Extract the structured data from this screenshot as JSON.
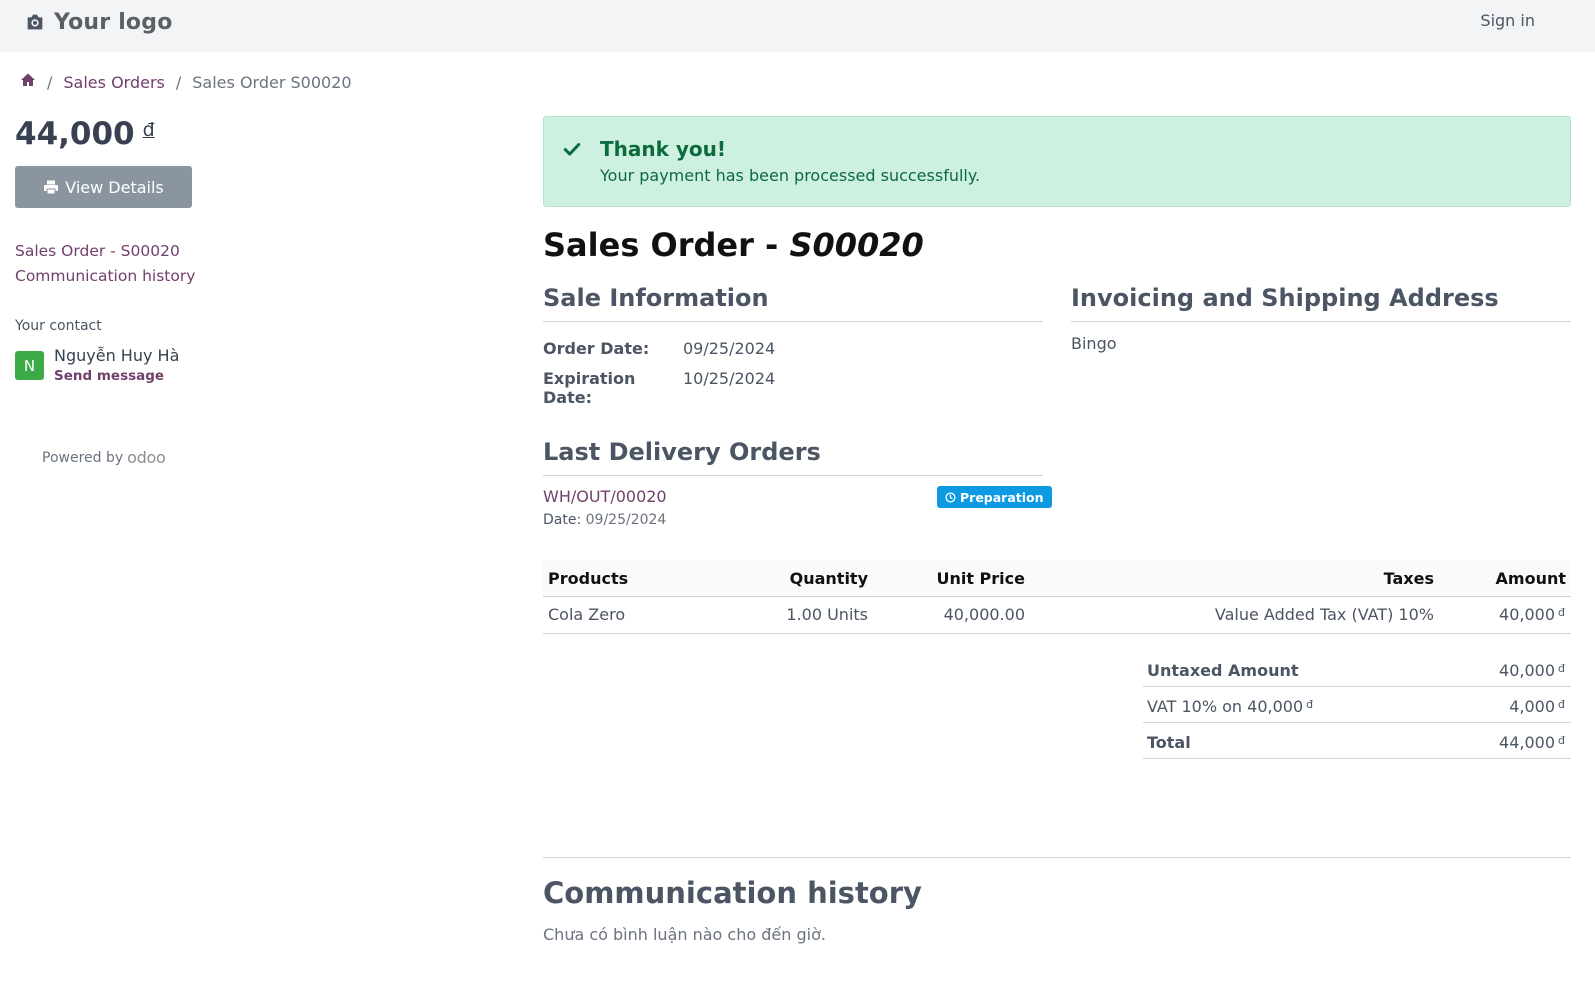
{
  "header": {
    "logo_text": "Your logo",
    "logo_icon": "camera-icon",
    "signin_label": "Sign in"
  },
  "breadcrumb": {
    "home_icon": "home-icon",
    "items": [
      "Sales Orders",
      "Sales Order S00020"
    ]
  },
  "sidebar": {
    "amount": "44,000",
    "currency": "đ",
    "view_details_label": "View Details",
    "view_details_icon": "print-icon",
    "nav": [
      "Sales Order - S00020",
      "Communication history"
    ],
    "contact_label": "Your contact",
    "contact": {
      "initial": "N",
      "name": "Nguyễn Huy Hà",
      "send_message": "Send message"
    },
    "powered_by": "Powered by",
    "brand": "odoo"
  },
  "alert": {
    "title": "Thank you!",
    "message": "Your payment has been processed successfully.",
    "icon": "check-icon"
  },
  "order": {
    "title_prefix": "Sales Order - ",
    "number": "S00020",
    "sale_info_heading": "Sale Information",
    "order_date_label": "Order Date:",
    "order_date": "09/25/2024",
    "expiration_label": "Expiration Date:",
    "expiration_date": "10/25/2024",
    "address_heading": "Invoicing and Shipping Address",
    "address": "Bingo"
  },
  "delivery": {
    "heading": "Last Delivery Orders",
    "ref": "WH/OUT/00020",
    "date_label": "Date:",
    "date": "09/25/2024",
    "status": "Preparation",
    "status_color": "#0d9ae3"
  },
  "table": {
    "headers": [
      "Products",
      "Quantity",
      "Unit Price",
      "Taxes",
      "Amount"
    ],
    "rows": [
      {
        "product": "Cola Zero",
        "quantity": "1.00 Units",
        "unit_price": "40,000.00",
        "taxes": "Value Added Tax (VAT) 10%",
        "amount": "40,000",
        "currency": "đ"
      }
    ]
  },
  "totals": {
    "untaxed_label": "Untaxed Amount",
    "untaxed": "40,000",
    "vat_label": "VAT 10% on 40,000",
    "vat": "4,000",
    "total_label": "Total",
    "total": "44,000",
    "currency": "đ"
  },
  "communication": {
    "heading": "Communication history",
    "empty": "Chưa có bình luận nào cho đến giờ."
  },
  "colors": {
    "link": "#71406d",
    "success_bg": "#cdf0e0",
    "success_text": "#0b6b3d",
    "button_bg": "#8a95a0",
    "avatar_bg": "#3daa48"
  }
}
